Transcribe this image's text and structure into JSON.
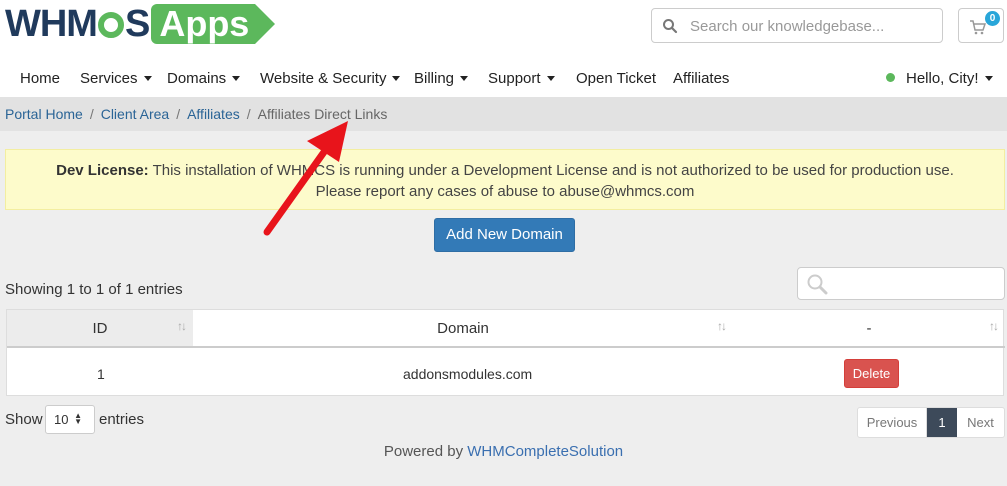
{
  "header": {
    "logo_left": "WHM",
    "logo_right": "S",
    "logo_apps": "Apps",
    "search_placeholder": "Search our knowledgebase...",
    "cart_count": "0"
  },
  "nav": {
    "home": "Home",
    "services": "Services",
    "domains": "Domains",
    "website_security": "Website & Security",
    "billing": "Billing",
    "support": "Support",
    "open_ticket": "Open Ticket",
    "affiliates": "Affiliates",
    "hello": "Hello, City!"
  },
  "breadcrumb": {
    "portal_home": "Portal Home",
    "client_area": "Client Area",
    "affiliates": "Affiliates",
    "current": "Affiliates Direct Links",
    "separator": "/"
  },
  "alert": {
    "label": "Dev License:",
    "line1": "This installation of WHMCS is running under a Development License and is not authorized to be used for production use.",
    "line2": "Please report any cases of abuse to abuse@whmcs.com"
  },
  "actions": {
    "add_domain": "Add New Domain"
  },
  "table": {
    "info": "Showing 1 to 1 of 1 entries",
    "columns": [
      "ID",
      "Domain",
      "-"
    ],
    "rows": [
      {
        "id": "1",
        "domain": "addonsmodules.com",
        "action": "Delete"
      }
    ],
    "show_label": "Show",
    "page_length": "10",
    "entries_label": "entries"
  },
  "pagination": {
    "previous": "Previous",
    "current": "1",
    "next": "Next"
  },
  "footer": {
    "powered_by": "Powered by",
    "link": "WHMCompleteSolution"
  },
  "colors": {
    "brand_navy": "#203a5c",
    "brand_green": "#5cb85c",
    "primary": "#337ab7",
    "danger": "#d9534f",
    "alert_bg": "#fdfbcb",
    "annotation": "#e8141b"
  }
}
